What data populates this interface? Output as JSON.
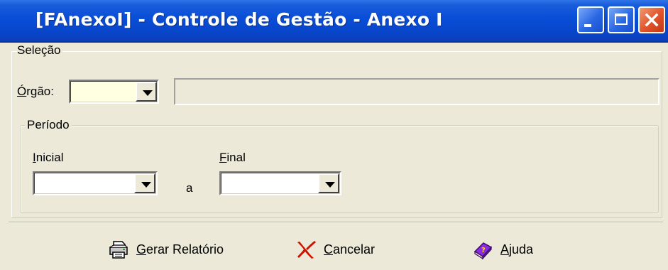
{
  "window": {
    "title": "[FAnexoI] - Controle de Gestão - Anexo I",
    "controls": [
      "minimize",
      "maximize",
      "close"
    ]
  },
  "selecao": {
    "legend": "Seleção",
    "orgao": {
      "label_first": "Ó",
      "label_rest": "rgão:",
      "value": "",
      "description": ""
    }
  },
  "periodo": {
    "legend": "Período",
    "inicial": {
      "label_first": "I",
      "label_rest": "nicial",
      "value": ""
    },
    "separator": "a",
    "final": {
      "label_first": "F",
      "label_rest": "inal",
      "value": ""
    }
  },
  "buttons": {
    "gerar": {
      "hotkey": "G",
      "rest": "erar Relatório",
      "icon": "printer-icon"
    },
    "cancelar": {
      "hotkey": "C",
      "rest": "ancelar",
      "icon": "cross-icon"
    },
    "ajuda": {
      "hotkey": "A",
      "rest": "juda",
      "icon": "help-book-icon"
    }
  },
  "colors": {
    "titlebar": "#0a4fd8",
    "window_bg": "#ECE9D8",
    "orgao_field_bg": "#FFFFE1",
    "cancel_red": "#CC1100"
  }
}
